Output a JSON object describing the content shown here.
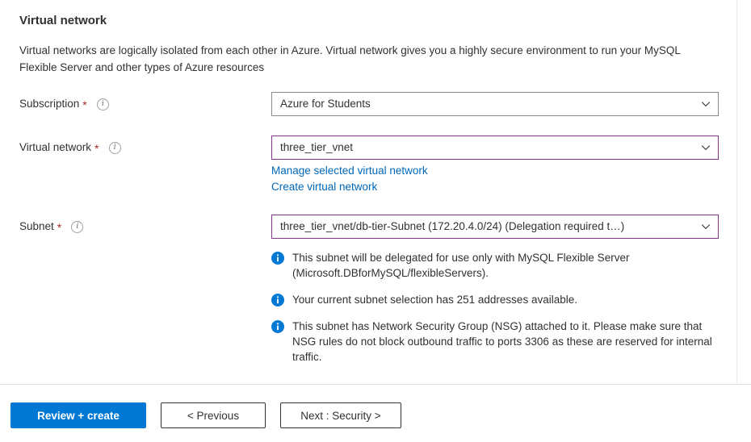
{
  "section": {
    "title": "Virtual network",
    "description": "Virtual networks are logically isolated from each other in Azure. Virtual network gives you a highly secure environment to run your MySQL Flexible Server and other types of Azure resources"
  },
  "fields": {
    "subscription": {
      "label": "Subscription",
      "required_marker": "*",
      "value": "Azure for Students"
    },
    "virtual_network": {
      "label": "Virtual network",
      "required_marker": "*",
      "value": "three_tier_vnet",
      "links": [
        {
          "label": "Manage selected virtual network"
        },
        {
          "label": "Create virtual network"
        }
      ]
    },
    "subnet": {
      "label": "Subnet",
      "required_marker": "*",
      "value": "three_tier_vnet/db-tier-Subnet (172.20.4.0/24) (Delegation required t…)"
    }
  },
  "info_messages": [
    {
      "text": "This subnet will be delegated for use only with MySQL Flexible Server (Microsoft.DBforMySQL/flexibleServers)."
    },
    {
      "text": "Your current subnet selection has 251 addresses available."
    },
    {
      "text": "This subnet has Network Security Group (NSG) attached to it. Please make sure that NSG rules do not block outbound traffic to ports 3306 as these are reserved for internal traffic."
    }
  ],
  "footer": {
    "review_create_label": "Review + create",
    "previous_label": "< Previous",
    "next_label": "Next : Security >"
  },
  "colors": {
    "primary_button": "#0078d4",
    "link": "#0067b8",
    "required_asterisk": "#a4262c",
    "visited_field_border": "#86348b",
    "info_icon": "#0078d4",
    "default_field_border": "#8a8886"
  }
}
